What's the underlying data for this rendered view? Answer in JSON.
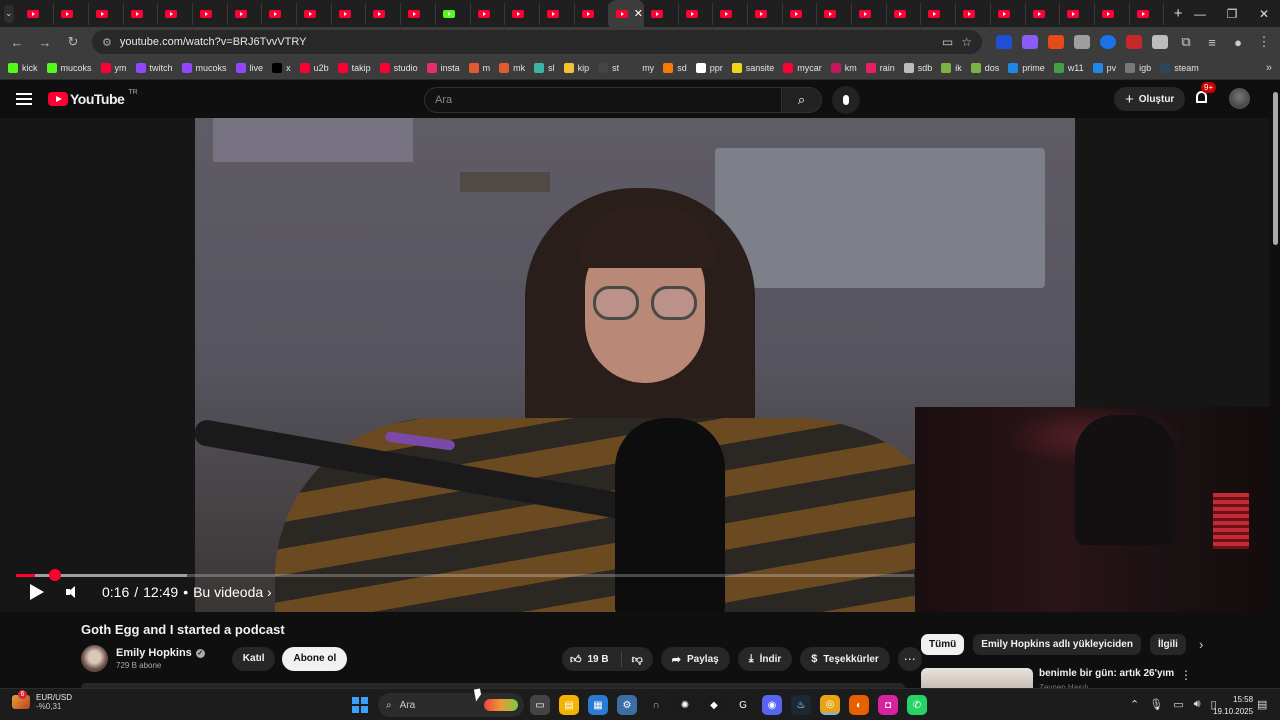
{
  "browser": {
    "tab_count": 33,
    "active_tab_index": 17,
    "green_tab_index": 12,
    "new_tab_icon": "plus-icon",
    "window_controls": [
      "minimize-icon",
      "restore-icon",
      "close-icon"
    ],
    "url": "youtube.com/watch?v=BRJ6TvvVTRY",
    "bookmarks": [
      {
        "label": "kick",
        "color": "#53fc18"
      },
      {
        "label": "mucoks",
        "color": "#53fc18"
      },
      {
        "label": "ym",
        "color": "#ff0033"
      },
      {
        "label": "twitch",
        "color": "#9146ff"
      },
      {
        "label": "mucoks",
        "color": "#9146ff"
      },
      {
        "label": "live",
        "color": "#9146ff"
      },
      {
        "label": "x",
        "color": "#000000"
      },
      {
        "label": "u2b",
        "color": "#ff0033"
      },
      {
        "label": "takip",
        "color": "#ff0033"
      },
      {
        "label": "studio",
        "color": "#ff0033"
      },
      {
        "label": "insta",
        "color": "#e1306c"
      },
      {
        "label": "m",
        "color": "#e15a33"
      },
      {
        "label": "mk",
        "color": "#e15a33"
      },
      {
        "label": "sl",
        "color": "#3bb6a6"
      },
      {
        "label": "kip",
        "color": "#f2c230"
      },
      {
        "label": "st",
        "color": "#444444"
      },
      {
        "label": "my",
        "color": "#3c3c3c"
      },
      {
        "label": "sd",
        "color": "#f57c00"
      },
      {
        "label": "ppr",
        "color": "#ffffff"
      },
      {
        "label": "sansite",
        "color": "#f2d31b"
      },
      {
        "label": "mycar",
        "color": "#ff0033"
      },
      {
        "label": "km",
        "color": "#c2185b"
      },
      {
        "label": "rain",
        "color": "#e91e63"
      },
      {
        "label": "sdb",
        "color": "#bbbbbb"
      },
      {
        "label": "ik",
        "color": "#7cb342"
      },
      {
        "label": "dos",
        "color": "#7cb342"
      },
      {
        "label": "prime",
        "color": "#1e88e5"
      },
      {
        "label": "w11",
        "color": "#43a047"
      },
      {
        "label": "pv",
        "color": "#1e88e5"
      },
      {
        "label": "igb",
        "color": "#777777"
      },
      {
        "label": "steam",
        "color": "#2a475e"
      }
    ]
  },
  "youtube": {
    "logo_text": "YouTube",
    "country": "TR",
    "search_placeholder": "Ara",
    "create_label": "Oluştur",
    "notifications": "9+",
    "video": {
      "title": "Goth Egg and I started a podcast",
      "current_time": "0:16",
      "duration": "12:49",
      "chapter_label": "Bu videoda",
      "progress_fraction": 0.0208,
      "buffered_fraction": 0.19
    },
    "channel": {
      "name": "Emily Hopkins",
      "verified_icon": "✓",
      "subscribers": "729 B abone",
      "join_label": "Katıl",
      "subscribe_label": "Abone ol"
    },
    "actions": {
      "likes": "19 B",
      "share_label": "Paylaş",
      "download_label": "İndir",
      "thanks_label": "Teşekkürler"
    },
    "chips": [
      "Tümü",
      "Emily Hopkins adlı yükleyiciden",
      "İlgili"
    ],
    "recommendation": {
      "title": "benimle bir gün: artık 26'yım",
      "channel": "Zeynep Hasılı"
    }
  },
  "taskbar": {
    "widget_pair": "EUR/USD",
    "widget_change": "-%0,31",
    "widget_badge": "6",
    "search_placeholder": "Ara",
    "time": "15:58",
    "date": "19.10.2025"
  }
}
